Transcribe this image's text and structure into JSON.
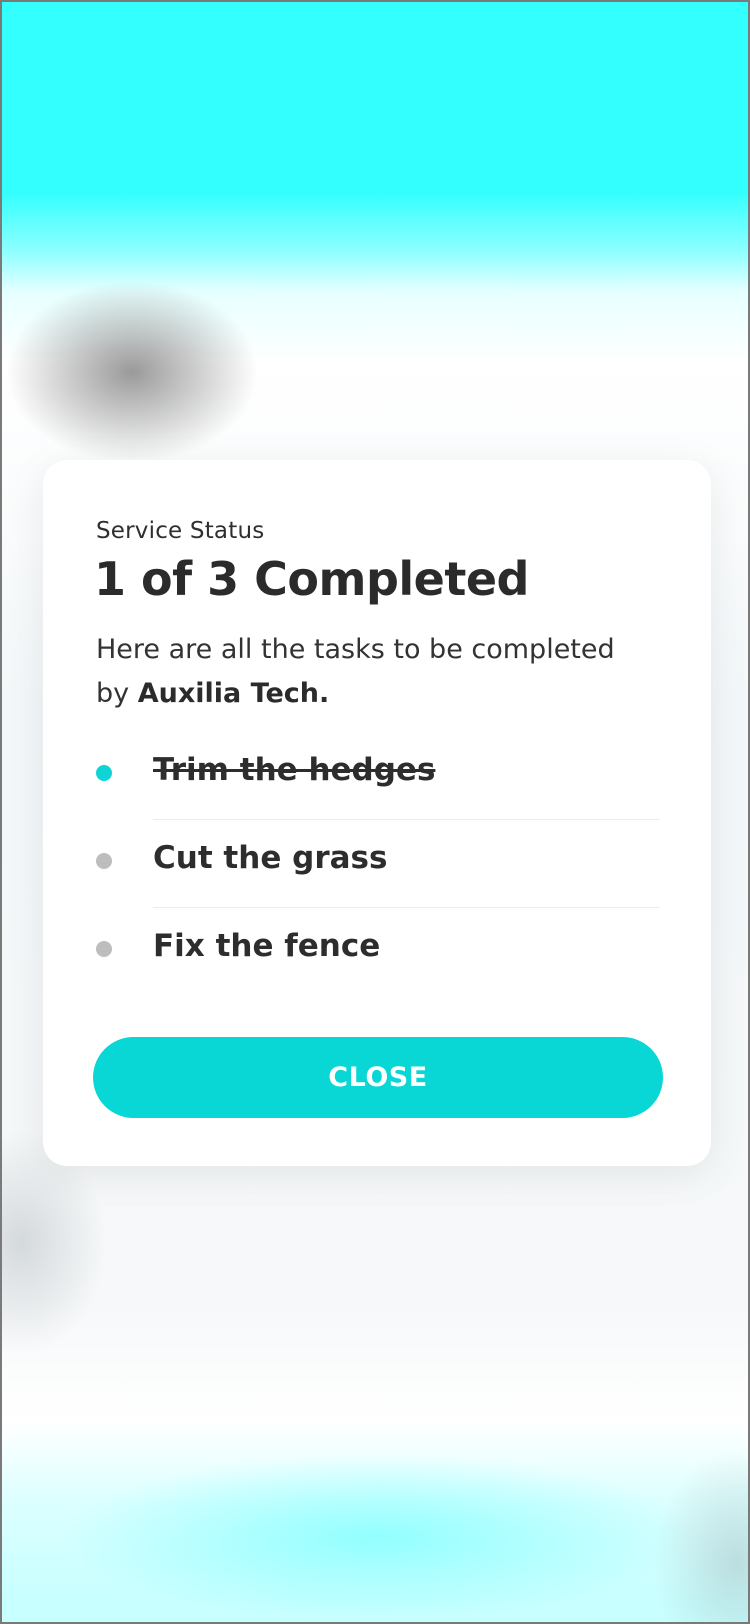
{
  "status_card": {
    "eyebrow": "Service Status",
    "headline": "1 of 3 Completed",
    "description_prefix": "Here are all the tasks to be completed by ",
    "provider_name": "Auxilia Tech.",
    "tasks": [
      {
        "label": "Trim the hedges",
        "completed": true
      },
      {
        "label": "Cut the grass",
        "completed": false
      },
      {
        "label": "Fix the fence",
        "completed": false
      }
    ],
    "close_label": "CLOSE"
  },
  "colors": {
    "accent": "#08d7d6",
    "completed_dot": "#10d3d5",
    "pending_dot": "#bdbdbd",
    "text": "#2b2b2b"
  }
}
